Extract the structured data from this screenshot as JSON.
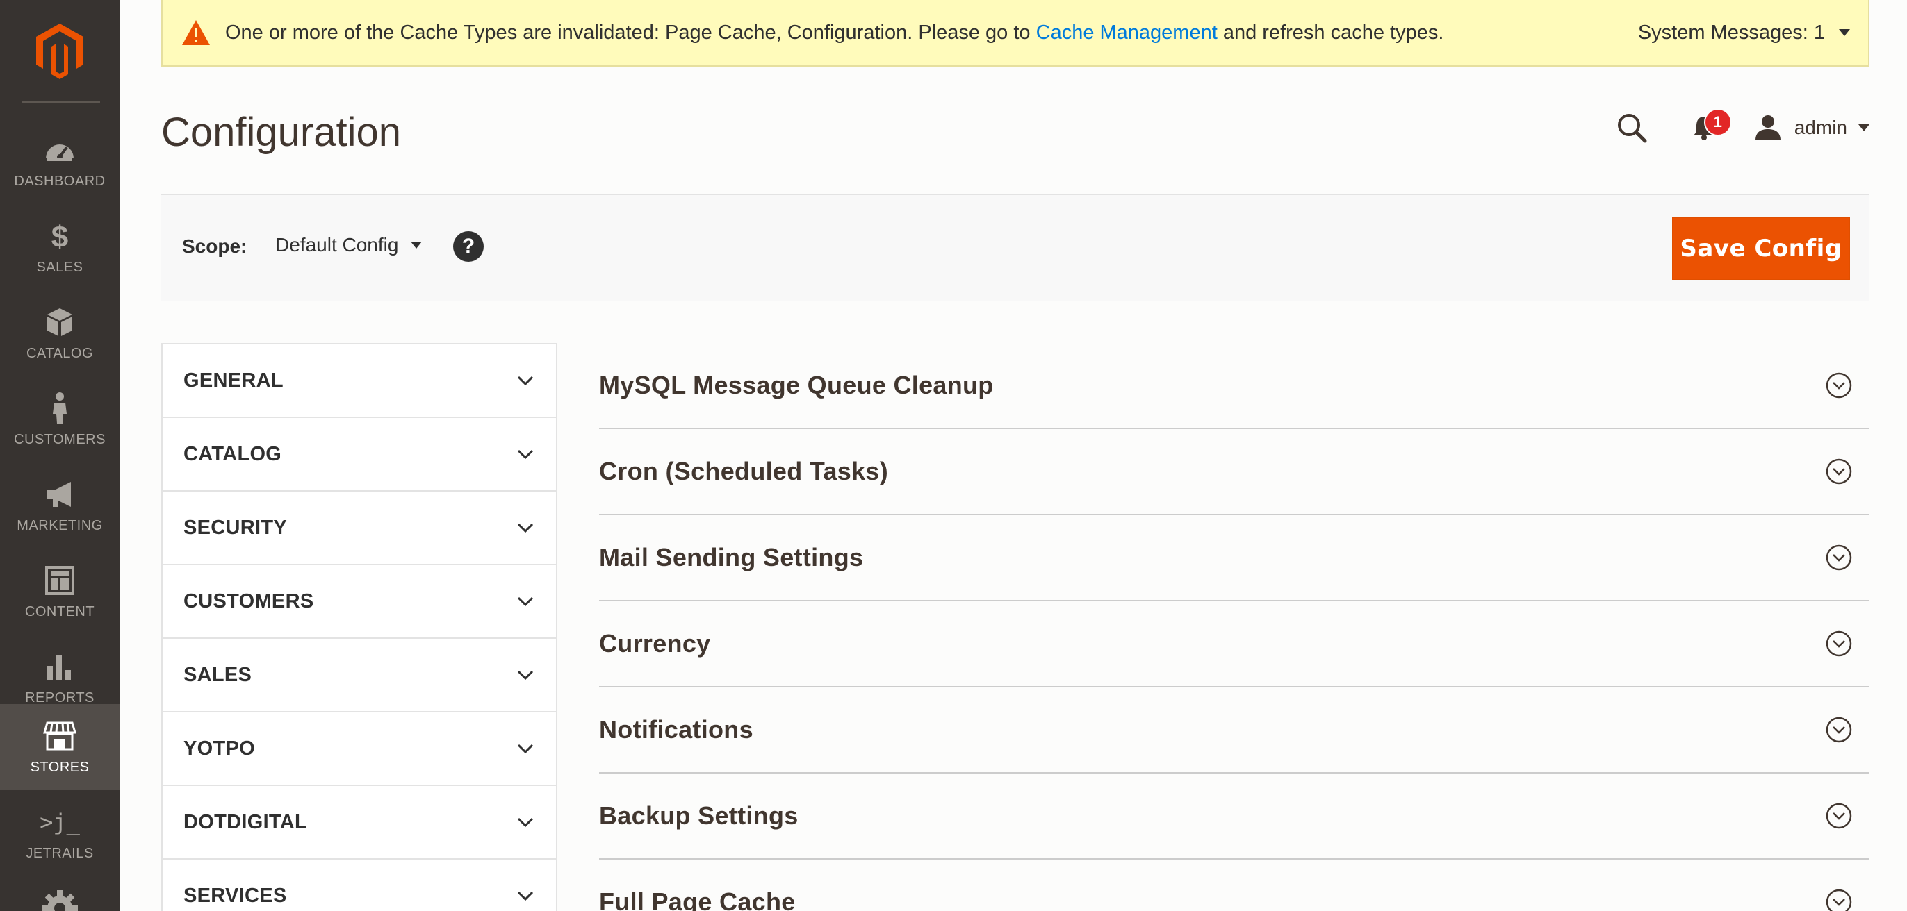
{
  "menu": {
    "items": [
      {
        "label": "DASHBOARD",
        "icon": "dashboard-icon"
      },
      {
        "label": "SALES",
        "icon": "dollar-icon"
      },
      {
        "label": "CATALOG",
        "icon": "box-icon"
      },
      {
        "label": "CUSTOMERS",
        "icon": "person-icon"
      },
      {
        "label": "MARKETING",
        "icon": "megaphone-icon"
      },
      {
        "label": "CONTENT",
        "icon": "layout-icon"
      },
      {
        "label": "REPORTS",
        "icon": "bar-chart-icon"
      },
      {
        "label": "STORES",
        "icon": "storefront-icon"
      },
      {
        "label": "JETRAILS",
        "icon": "terminal-icon"
      }
    ],
    "active": "STORES",
    "jetrails_glyph": ">j_"
  },
  "system_message": {
    "text_before": "One or more of the Cache Types are invalidated: Page Cache, Configuration. Please go to ",
    "link_text": "Cache Management",
    "text_after": " and refresh cache types.",
    "count_label": "System Messages: 1"
  },
  "header": {
    "title": "Configuration",
    "notification_count": "1",
    "user_name": "admin"
  },
  "toolbar": {
    "scope_label": "Scope:",
    "scope_value": "Default Config",
    "help_glyph": "?",
    "save_label": "Save Config"
  },
  "tabs": [
    {
      "label": "GENERAL"
    },
    {
      "label": "CATALOG"
    },
    {
      "label": "SECURITY"
    },
    {
      "label": "CUSTOMERS"
    },
    {
      "label": "SALES"
    },
    {
      "label": "YOTPO"
    },
    {
      "label": "DOTDIGITAL"
    },
    {
      "label": "SERVICES"
    }
  ],
  "sections": [
    {
      "title": "MySQL Message Queue Cleanup"
    },
    {
      "title": "Cron (Scheduled Tasks)"
    },
    {
      "title": "Mail Sending Settings"
    },
    {
      "title": "Currency"
    },
    {
      "title": "Notifications"
    },
    {
      "title": "Backup Settings"
    },
    {
      "title": "Full Page Cache"
    }
  ],
  "colors": {
    "menu_bg": "#373330",
    "accent": "#eb5202",
    "link": "#007bdb",
    "warning_bg": "#fffbbb",
    "badge": "#e22626"
  }
}
